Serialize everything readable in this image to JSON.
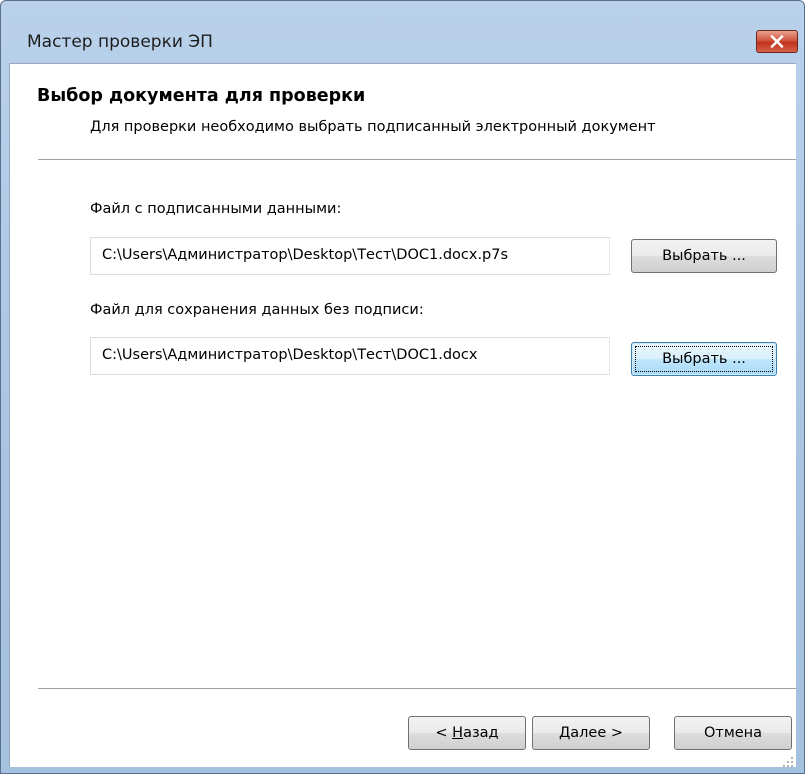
{
  "window": {
    "title": "Мастер проверки ЭП",
    "close_icon": "close-icon",
    "close_color": "#c7402a"
  },
  "header": {
    "title": "Выбор документа для проверки",
    "subtitle": "Для проверки необходимо выбрать подписанный электронный документ"
  },
  "fields": {
    "signed_file": {
      "label": "Файл с подписанными данными:",
      "value": "C:\\Users\\Администратор\\Desktop\\Тест\\DOC1.docx.p7s",
      "browse_label": "Выбрать ..."
    },
    "output_file": {
      "label": "Файл для сохранения данных без подписи:",
      "value": "C:\\Users\\Администратор\\Desktop\\Тест\\DOC1.docx",
      "browse_label": "Выбрать ..."
    }
  },
  "footer": {
    "back_prefix": "< ",
    "back_mnemonic": "Н",
    "back_rest": "азад",
    "next_mnemonic": "Д",
    "next_rest": "алее >",
    "cancel_label": "Отмена"
  },
  "colors": {
    "frame": "#b9d1ea",
    "focused_button": "#3c7fb1"
  }
}
